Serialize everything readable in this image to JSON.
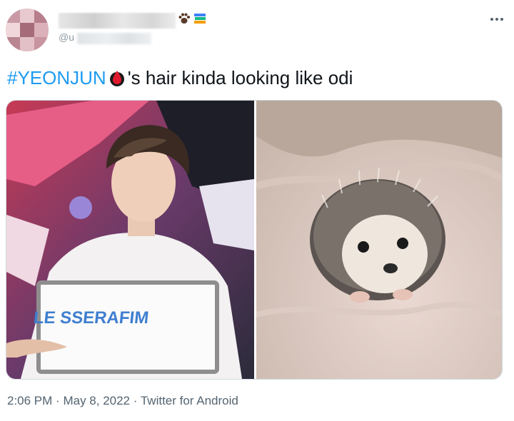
{
  "author": {
    "handle_prefix": "@u"
  },
  "tweet": {
    "hashtag": "#YEONJUN",
    "text_after": "'s hair kinda looking like odi",
    "image_left_sign_text": "LE SSERAFIM"
  },
  "meta": {
    "time": "2:06 PM",
    "separator": "·",
    "date": "May 8, 2022",
    "source": "Twitter for Android"
  },
  "icons": [
    "paw-emoji-icon",
    "books-emoji-icon",
    "more-options-icon",
    "blood-drop-emoji-icon"
  ],
  "colors": {
    "link": "#1d9bf0",
    "text": "#0f1419",
    "secondary": "#536471"
  }
}
